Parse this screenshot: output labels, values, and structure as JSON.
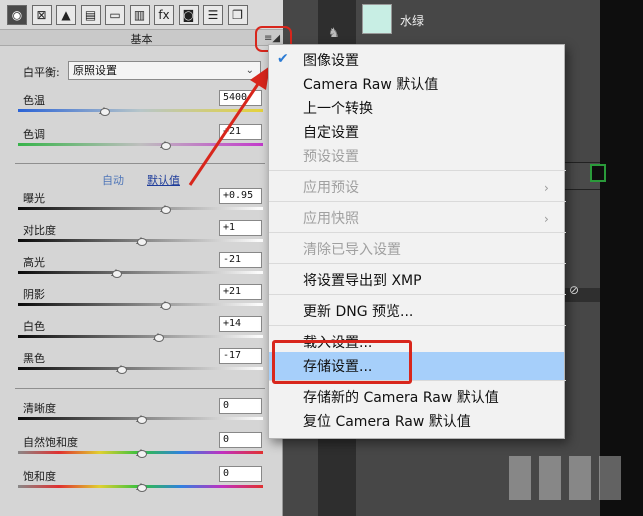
{
  "toolbar": {
    "tools": [
      {
        "icon": "aperture-icon",
        "glyph": "◉",
        "active": true
      },
      {
        "icon": "tone-curve-icon",
        "glyph": "⊠",
        "active": false
      },
      {
        "icon": "triangle-icon",
        "glyph": "▲",
        "active": false
      },
      {
        "icon": "hsl-icon",
        "glyph": "▤",
        "active": false
      },
      {
        "icon": "split-tone-icon",
        "glyph": "▭",
        "active": false
      },
      {
        "icon": "lens-icon",
        "glyph": "▥",
        "active": false
      },
      {
        "icon": "fx-icon",
        "glyph": "fx",
        "active": false
      },
      {
        "icon": "camera-icon",
        "glyph": "◙",
        "active": false
      },
      {
        "icon": "presets-icon",
        "glyph": "☰",
        "active": false
      },
      {
        "icon": "snapshots-icon",
        "glyph": "❐",
        "active": false
      }
    ]
  },
  "panel": {
    "title": "基本",
    "menu_icon": "≡◢"
  },
  "white_balance": {
    "label": "白平衡:",
    "value": "原照设置"
  },
  "sliders_top": [
    {
      "label": "色温",
      "value": "5400",
      "position": 0.35,
      "track": "temp"
    },
    {
      "label": "色调",
      "value": "+21",
      "position": 0.6,
      "track": "tint"
    }
  ],
  "links": {
    "auto": "自动",
    "default": "默认值"
  },
  "sliders_tone": [
    {
      "label": "曝光",
      "value": "+0.95",
      "position": 0.6,
      "track": "bw"
    },
    {
      "label": "对比度",
      "value": "+1",
      "position": 0.5,
      "track": "bw"
    },
    {
      "label": "高光",
      "value": "-21",
      "position": 0.4,
      "track": "bw"
    },
    {
      "label": "阴影",
      "value": "+21",
      "position": 0.6,
      "track": "bw"
    },
    {
      "label": "白色",
      "value": "+14",
      "position": 0.57,
      "track": "bw"
    },
    {
      "label": "黑色",
      "value": "-17",
      "position": 0.42,
      "track": "bw"
    }
  ],
  "sliders_presence": [
    {
      "label": "清晰度",
      "value": "0",
      "position": 0.5,
      "track": "bw"
    },
    {
      "label": "自然饱和度",
      "value": "0",
      "position": 0.5,
      "track": "rainbow"
    },
    {
      "label": "饱和度",
      "value": "0",
      "position": 0.5,
      "track": "rainbow"
    }
  ],
  "right_panel": {
    "swatch_label": "水绿",
    "swatch_color": "#c8eee4"
  },
  "context_menu": {
    "items": [
      {
        "label": "图像设置",
        "checked": true,
        "disabled": false
      },
      {
        "label": "Camera Raw 默认值",
        "disabled": false
      },
      {
        "label": "上一个转换",
        "disabled": false
      },
      {
        "label": "自定设置",
        "disabled": false
      },
      {
        "label": "预设设置",
        "disabled": true
      },
      {
        "label": "应用预设",
        "disabled": true,
        "submenu": true
      },
      {
        "label": "应用快照",
        "disabled": true,
        "submenu": true
      },
      {
        "label": "清除已导入设置",
        "disabled": true
      },
      {
        "label": "将设置导出到 XMP",
        "disabled": false
      },
      {
        "label": "更新 DNG 预览...",
        "disabled": false
      },
      {
        "label": "载入设置...",
        "disabled": false
      },
      {
        "label": "存储设置...",
        "disabled": false,
        "highlighted": true
      },
      {
        "label": "存储新的 Camera Raw 默认值",
        "disabled": false
      },
      {
        "label": "复位 Camera Raw 默认值",
        "disabled": false
      }
    ]
  },
  "colors": {
    "highlight": "#a6cffa",
    "annotation_red": "#d8261c",
    "check_blue": "#2b7bd4"
  }
}
